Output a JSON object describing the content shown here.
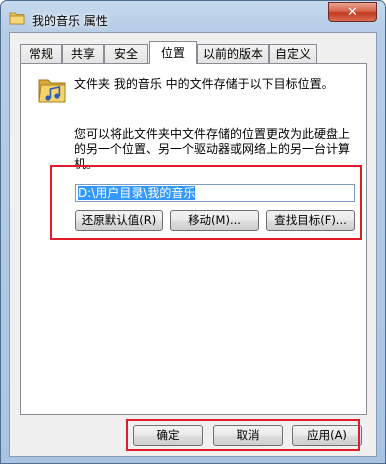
{
  "window": {
    "title": "我的音乐 属性",
    "close_glyph": "✕"
  },
  "tabs": [
    {
      "label": "常规"
    },
    {
      "label": "共享"
    },
    {
      "label": "安全"
    },
    {
      "label": "位置",
      "active": true
    },
    {
      "label": "以前的版本"
    },
    {
      "label": "自定义"
    }
  ],
  "location": {
    "description": "文件夹 我的音乐 中的文件存储于以下目标位置。",
    "explanation": "您可以将此文件夹中文件存储的位置更改为此硬盘上的另一个位置、另一个驱动器或网络上的另一台计算机。",
    "path_value": "D:\\用户目录\\我的音乐",
    "restore_default_label": "还原默认值(R)",
    "move_label": "移动(M)...",
    "find_target_label": "查找目标(F)..."
  },
  "footer": {
    "ok_label": "确定",
    "cancel_label": "取消",
    "apply_label": "应用(A)"
  },
  "colors": {
    "highlight": "#e21b2b",
    "selection": "#3399ff",
    "close_button": "#c0391f"
  },
  "icons": {
    "title": "folder-music-icon",
    "location": "folder-music-icon",
    "close": "close-icon"
  }
}
